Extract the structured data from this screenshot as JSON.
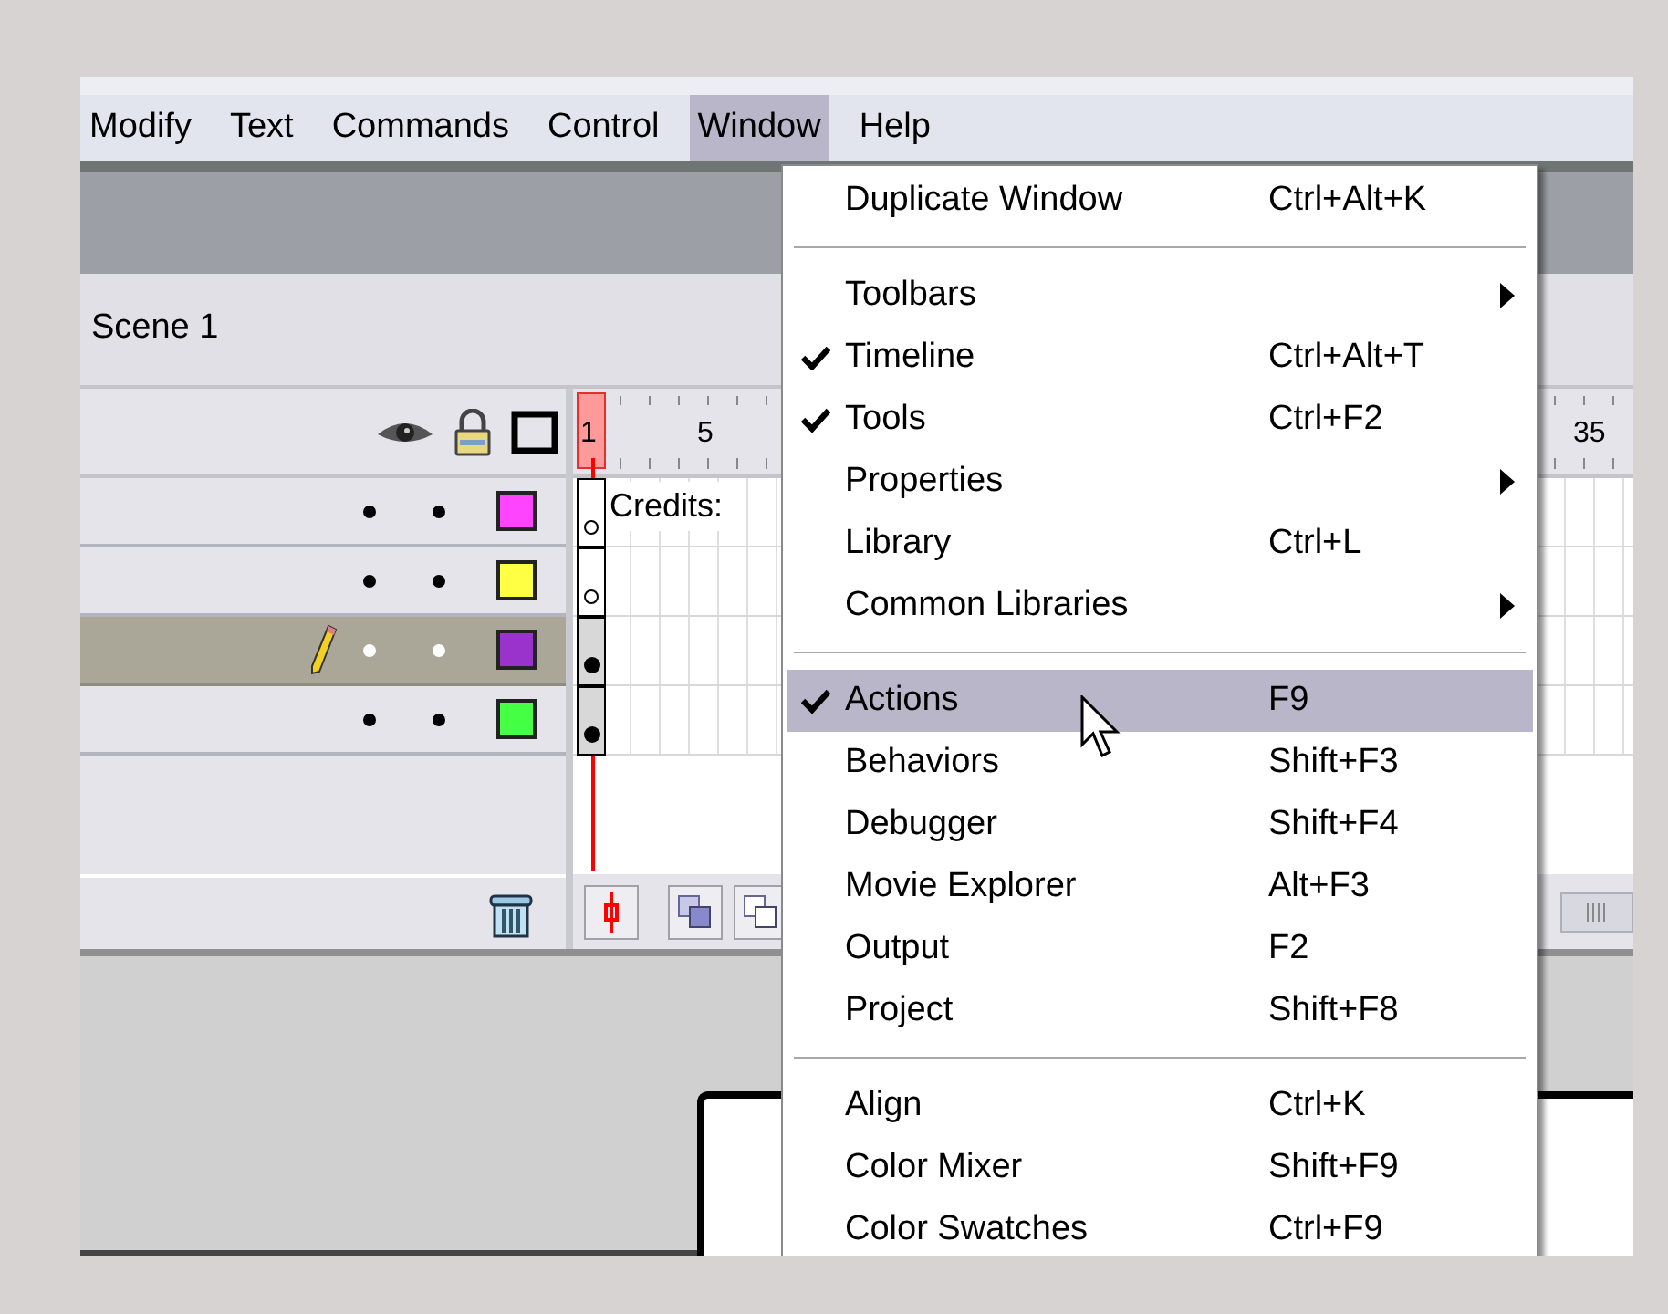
{
  "menubar": [
    {
      "label": "Modify",
      "selected": false
    },
    {
      "label": "Text",
      "selected": false
    },
    {
      "label": "Commands",
      "selected": false
    },
    {
      "label": "Control",
      "selected": false
    },
    {
      "label": "Window",
      "selected": true
    },
    {
      "label": "Help",
      "selected": false
    }
  ],
  "scene": {
    "label": "Scene 1"
  },
  "timeline": {
    "ruler_labels": [
      "1",
      "5",
      "35"
    ],
    "frame_label": "Credits:",
    "layers": [
      {
        "color": "#ff44ff",
        "selected": false,
        "keyframe_filled": false
      },
      {
        "color": "#ffff44",
        "selected": false,
        "keyframe_filled": false
      },
      {
        "color": "#9933cc",
        "selected": true,
        "keyframe_filled": true
      },
      {
        "color": "#44ff44",
        "selected": false,
        "keyframe_filled": true
      }
    ]
  },
  "window_menu": [
    {
      "kind": "item",
      "label": "Duplicate Window",
      "shortcut": "Ctrl+Alt+K",
      "checked": false,
      "submenu": false,
      "selected": false
    },
    {
      "kind": "separator"
    },
    {
      "kind": "item",
      "label": "Toolbars",
      "checked": false,
      "submenu": true,
      "selected": false
    },
    {
      "kind": "item",
      "label": "Timeline",
      "shortcut": "Ctrl+Alt+T",
      "checked": true,
      "submenu": false,
      "selected": false
    },
    {
      "kind": "item",
      "label": "Tools",
      "shortcut": "Ctrl+F2",
      "checked": true,
      "submenu": false,
      "selected": false
    },
    {
      "kind": "item",
      "label": "Properties",
      "checked": false,
      "submenu": true,
      "selected": false
    },
    {
      "kind": "item",
      "label": "Library",
      "shortcut": "Ctrl+L",
      "checked": false,
      "submenu": false,
      "selected": false
    },
    {
      "kind": "item",
      "label": "Common Libraries",
      "checked": false,
      "submenu": true,
      "selected": false
    },
    {
      "kind": "separator"
    },
    {
      "kind": "item",
      "label": "Actions",
      "shortcut": "F9",
      "checked": true,
      "submenu": false,
      "selected": true
    },
    {
      "kind": "item",
      "label": "Behaviors",
      "shortcut": "Shift+F3",
      "checked": false,
      "submenu": false,
      "selected": false
    },
    {
      "kind": "item",
      "label": "Debugger",
      "shortcut": "Shift+F4",
      "checked": false,
      "submenu": false,
      "selected": false
    },
    {
      "kind": "item",
      "label": "Movie Explorer",
      "shortcut": "Alt+F3",
      "checked": false,
      "submenu": false,
      "selected": false
    },
    {
      "kind": "item",
      "label": "Output",
      "shortcut": "F2",
      "checked": false,
      "submenu": false,
      "selected": false
    },
    {
      "kind": "item",
      "label": "Project",
      "shortcut": "Shift+F8",
      "checked": false,
      "submenu": false,
      "selected": false
    },
    {
      "kind": "separator"
    },
    {
      "kind": "item",
      "label": "Align",
      "shortcut": "Ctrl+K",
      "checked": false,
      "submenu": false,
      "selected": false
    },
    {
      "kind": "item",
      "label": "Color Mixer",
      "shortcut": "Shift+F9",
      "checked": false,
      "submenu": false,
      "selected": false
    },
    {
      "kind": "item",
      "label": "Color Swatches",
      "shortcut": "Ctrl+F9",
      "checked": false,
      "submenu": false,
      "selected": false
    }
  ]
}
